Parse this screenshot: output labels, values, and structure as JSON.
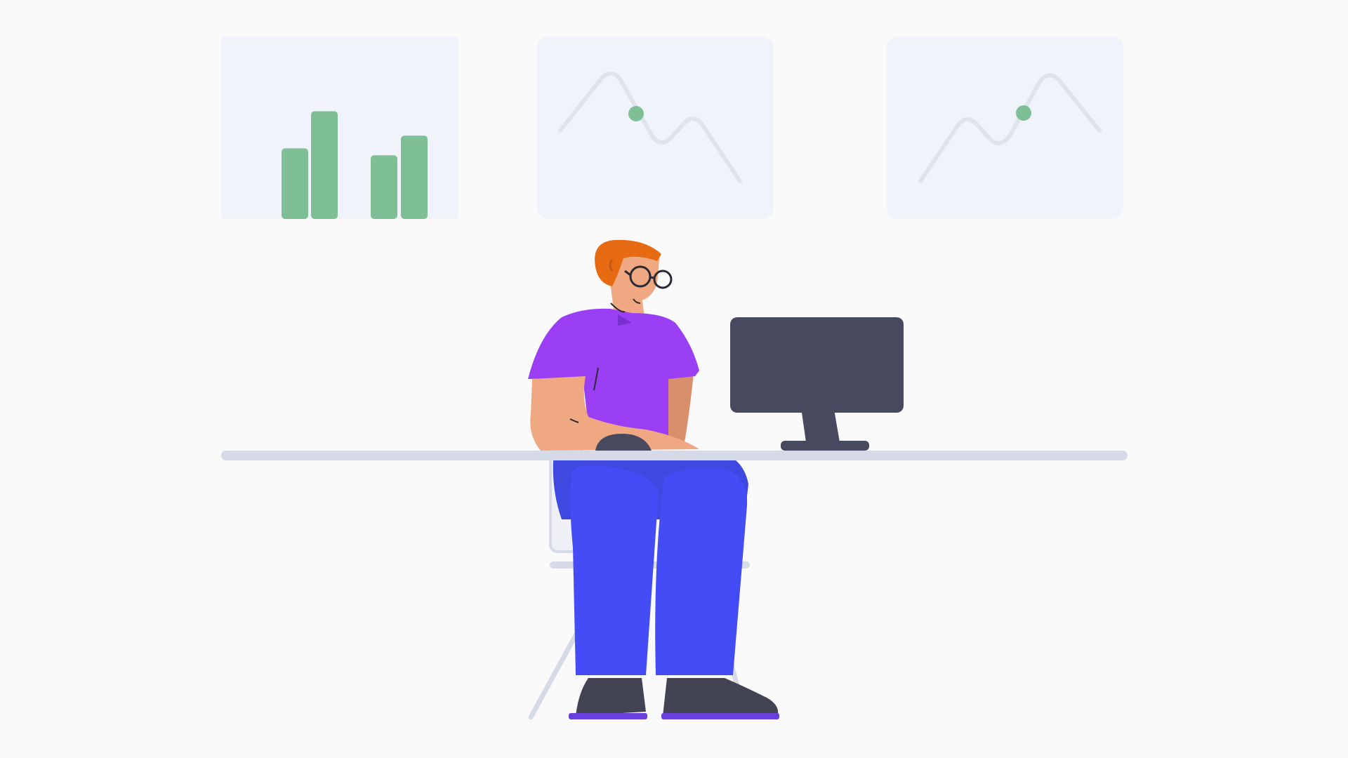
{
  "colors": {
    "background": "#fafafb",
    "panel": "#f0f4fa",
    "panel_line": "#dfe3ec",
    "accent_green": "#7fbf96",
    "desk": "#d6dae6",
    "monitor": "#474a5f",
    "shirt": "#9b3ff5",
    "pants": "#444df5",
    "skin": "#f0a882",
    "hair": "#e66a12",
    "shoes": "#424453",
    "soles": "#6a3fe0"
  },
  "panels": [
    {
      "id": "bar-chart-panel",
      "kind": "bar-chart",
      "bars": [
        0.61,
        0.93,
        0.55,
        0.72
      ]
    },
    {
      "id": "line-chart-panel-1",
      "kind": "line-chart",
      "trend": "down",
      "marker": "dot"
    },
    {
      "id": "line-chart-panel-2",
      "kind": "line-chart",
      "trend": "up",
      "marker": "dot"
    }
  ],
  "illustration": {
    "person": "person-with-glasses",
    "objects": [
      "desk",
      "desktop-monitor",
      "computer-mouse",
      "chair"
    ]
  }
}
